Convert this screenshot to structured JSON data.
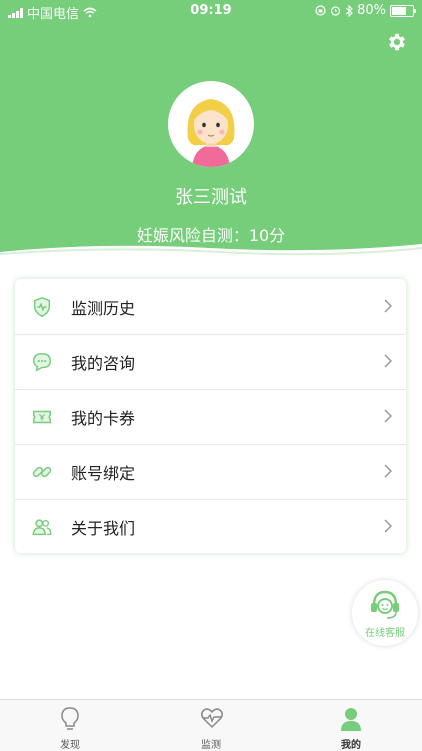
{
  "status_bar": {
    "carrier": "中国电信",
    "time": "09:19",
    "battery": "80%",
    "battery_level": 0.8
  },
  "profile": {
    "username": "张三测试",
    "risk_text": "妊娠风险自测：10分"
  },
  "menu": {
    "items": [
      {
        "label": "监测历史",
        "icon": "shield-heart-icon"
      },
      {
        "label": "我的咨询",
        "icon": "chat-bubble-icon"
      },
      {
        "label": "我的卡券",
        "icon": "coupon-icon"
      },
      {
        "label": "账号绑定",
        "icon": "link-icon"
      },
      {
        "label": "关于我们",
        "icon": "users-icon"
      }
    ]
  },
  "service": {
    "label": "在线客服",
    "icon": "headset-icon"
  },
  "tabbar": {
    "tabs": [
      {
        "label": "发现",
        "icon": "lightbulb-icon"
      },
      {
        "label": "监测",
        "icon": "heart-pulse-icon"
      },
      {
        "label": "我的",
        "icon": "person-icon"
      }
    ],
    "active": "我的"
  },
  "colors": {
    "accent": "#76cd7a",
    "card_shadow": "#c8eac9"
  }
}
